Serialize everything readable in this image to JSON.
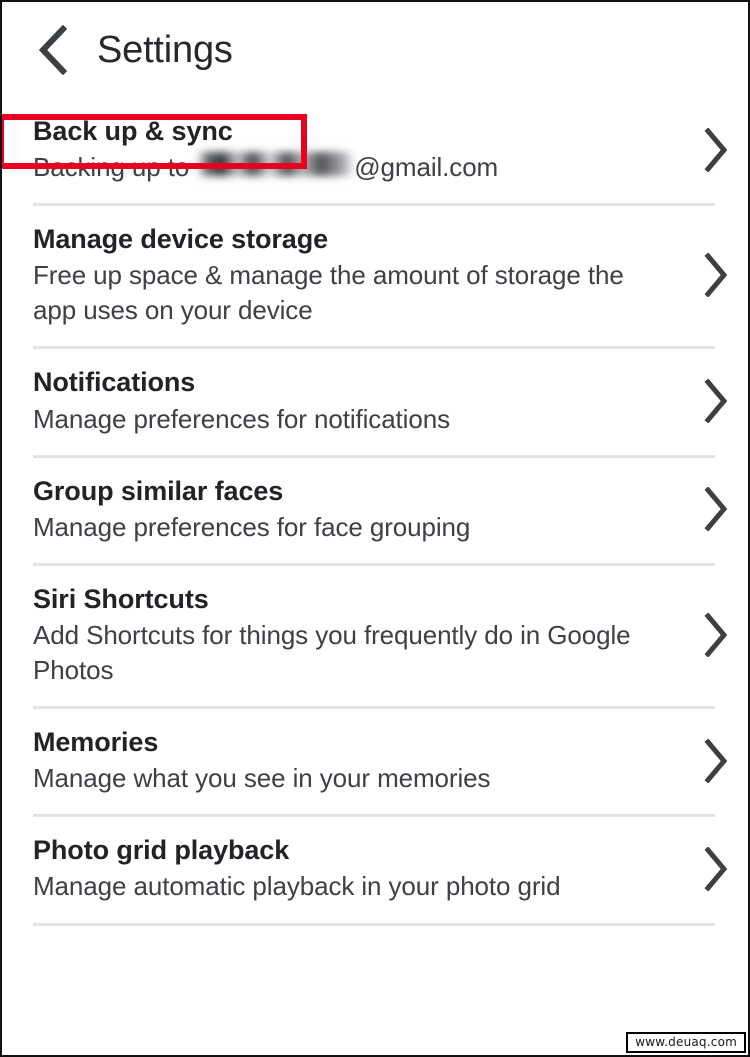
{
  "header": {
    "back_icon": "chevron-left-icon",
    "title": "Settings"
  },
  "highlight": {
    "color": "#e8021f",
    "target": "Back up & sync"
  },
  "chevron_icon": "chevron-right-icon",
  "settings": {
    "rows": [
      {
        "title": "Back up & sync",
        "subtitle_prefix": "Backing up to ",
        "subtitle_redacted": true,
        "subtitle_suffix": "@gmail.com",
        "subtitle": "Backing up to ████████@gmail.com"
      },
      {
        "title": "Manage device storage",
        "subtitle": "Free up space & manage the amount of storage the app uses on your device"
      },
      {
        "title": "Notifications",
        "subtitle": "Manage preferences for notifications"
      },
      {
        "title": "Group similar faces",
        "subtitle": "Manage preferences for face grouping"
      },
      {
        "title": "Siri Shortcuts",
        "subtitle": "Add Shortcuts for things you frequently do in Google Photos"
      },
      {
        "title": "Memories",
        "subtitle": "Manage what you see in your memories"
      },
      {
        "title": "Photo grid playback",
        "subtitle": "Manage automatic playback in your photo grid"
      }
    ]
  },
  "watermark": {
    "text": "www.deuaq.com"
  },
  "colors": {
    "title_text": "#212326",
    "subtitle_text": "#3d4044",
    "divider": "#e3e3e3",
    "highlight_red": "#e8021f",
    "background": "#ffffff"
  }
}
